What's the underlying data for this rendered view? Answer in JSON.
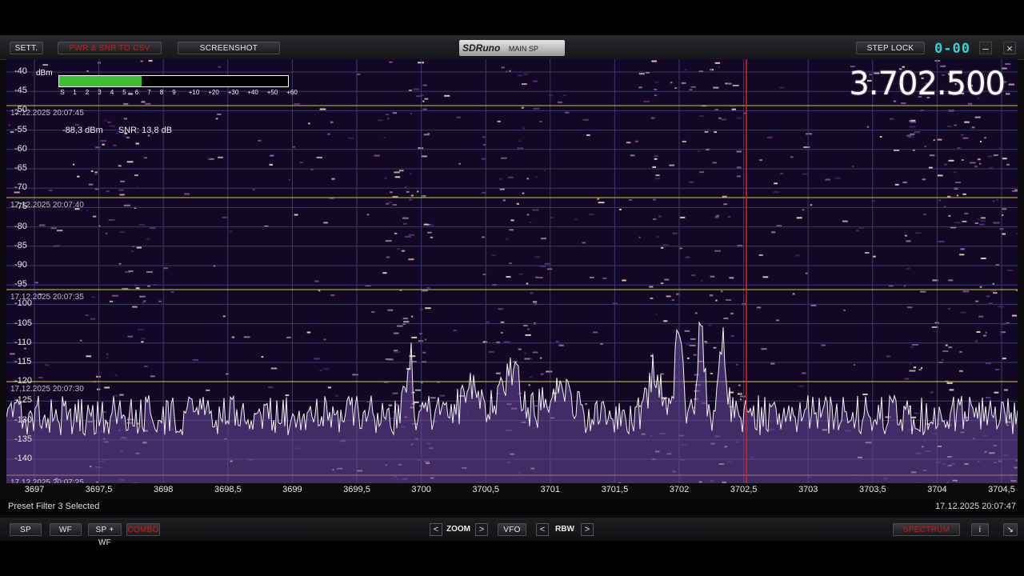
{
  "toolbar": {
    "sett": "SETT.",
    "pwr_snr": "PWR & SNR TO CSV",
    "screenshot": "SCREENSHOT",
    "logo_brand": "SDRuno",
    "logo_panel": "MAIN SP",
    "step_lock": "STEP LOCK",
    "digits": "0-00"
  },
  "spectrum": {
    "dbm_unit": "dBm",
    "db_labels": [
      "-40",
      "-45",
      "-50",
      "-55",
      "-60",
      "-65",
      "-70",
      "-75",
      "-80",
      "-85",
      "-90",
      "-95",
      "-100",
      "-105",
      "-110",
      "-115",
      "-120",
      "-125",
      "-130",
      "-135",
      "-140"
    ],
    "timestamps": [
      "17.12.2025 20:07:45",
      "17.12.2025 20:07:40",
      "17.12.2025 20:07:35",
      "17.12.2025 20:07:30",
      "17.12.2025 20:07:25"
    ],
    "power": "-88,3 dBm",
    "snr": "SNR: 13,8 dB",
    "frequency": "3.702.500",
    "s_meter": {
      "scale": [
        "S",
        "1",
        "2",
        "3",
        "4",
        "5",
        "6",
        "7",
        "8",
        "9",
        "+10",
        "+20",
        "+30",
        "+40",
        "+50",
        "+60"
      ],
      "level_fraction": 0.36,
      "color": "#3cbd32"
    },
    "x_labels": [
      "3697",
      "3697,5",
      "3698",
      "3698,5",
      "3699",
      "3699,5",
      "3700",
      "3700,5",
      "3701",
      "3701,5",
      "3702",
      "3702,5",
      "3703",
      "3703,5",
      "3704",
      "3704,5"
    ]
  },
  "status": {
    "left": "Preset Filter 3 Selected",
    "right": "17.12.2025 20:07:47"
  },
  "bottom": {
    "sp": "SP",
    "wf": "WF",
    "spwf": "SP + WF",
    "combo": "COMBO",
    "zoom": "ZOOM",
    "vfo": "VFO",
    "rbw": "RBW",
    "spectrum_btn": "SPECTRUM",
    "info": "i"
  }
}
